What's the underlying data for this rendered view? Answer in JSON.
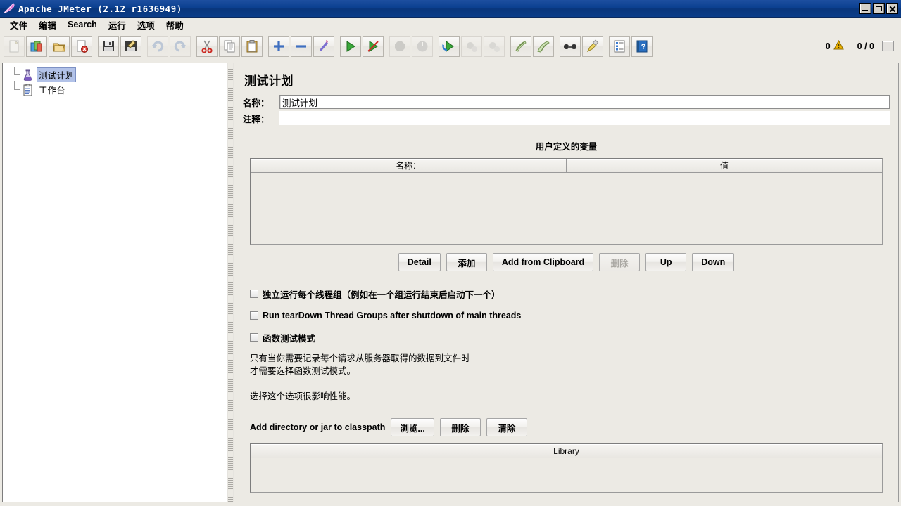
{
  "window": {
    "title": "Apache JMeter (2.12 r1636949)",
    "logo_icon": "jmeter-feather-icon",
    "minimize_icon": "minimize-icon",
    "maximize_icon": "maximize-icon",
    "close_icon": "close-icon"
  },
  "menu": {
    "items": [
      {
        "label": "文件"
      },
      {
        "label": "编辑"
      },
      {
        "label": "Search"
      },
      {
        "label": "运行"
      },
      {
        "label": "选项"
      },
      {
        "label": "帮助"
      }
    ]
  },
  "toolbar": {
    "buttons": [
      {
        "icon": "new-icon",
        "enabled": false
      },
      {
        "icon": "templates-icon",
        "enabled": true
      },
      {
        "icon": "open-icon",
        "enabled": true
      },
      {
        "icon": "close-file-icon",
        "enabled": true
      },
      {
        "icon": "save-icon",
        "enabled": true
      },
      {
        "icon": "save-as-icon",
        "enabled": true
      },
      {
        "icon": "undo-icon",
        "enabled": false
      },
      {
        "icon": "redo-icon",
        "enabled": false
      },
      {
        "icon": "cut-icon",
        "enabled": true
      },
      {
        "icon": "copy-icon",
        "enabled": true
      },
      {
        "icon": "paste-icon",
        "enabled": true
      },
      {
        "icon": "expand-all-icon",
        "enabled": true
      },
      {
        "icon": "collapse-all-icon",
        "enabled": true
      },
      {
        "icon": "toggle-icon",
        "enabled": true
      },
      {
        "icon": "start-icon",
        "enabled": true
      },
      {
        "icon": "start-no-pauses-icon",
        "enabled": true
      },
      {
        "icon": "stop-icon",
        "enabled": false
      },
      {
        "icon": "shutdown-icon",
        "enabled": false
      },
      {
        "icon": "remote-start-all-icon",
        "enabled": true
      },
      {
        "icon": "remote-stop-all-icon",
        "enabled": false
      },
      {
        "icon": "remote-shutdown-all-icon",
        "enabled": false
      },
      {
        "icon": "clear-icon",
        "enabled": true
      },
      {
        "icon": "clear-all-icon",
        "enabled": true
      },
      {
        "icon": "search-icon",
        "enabled": true
      },
      {
        "icon": "search-reset-icon",
        "enabled": true
      },
      {
        "icon": "function-helper-icon",
        "enabled": true
      },
      {
        "icon": "help-icon",
        "enabled": true
      }
    ],
    "status": {
      "error_count": "0",
      "warning_icon": "warning-triangle-icon",
      "threads": "0 / 0",
      "progress_icon": "progress-box-icon"
    }
  },
  "tree": {
    "nodes": [
      {
        "label": "测试计划",
        "icon": "test-plan-flask-icon",
        "selected": true
      },
      {
        "label": "工作台",
        "icon": "workbench-clipboard-icon",
        "selected": false
      }
    ]
  },
  "main": {
    "heading": "测试计划",
    "name_label": "名称：",
    "name_value": "测试计划",
    "comment_label": "注释：",
    "comment_value": "",
    "variables": {
      "title": "用户定义的变量",
      "columns": [
        "名称：",
        "值"
      ],
      "rows": []
    },
    "var_buttons": [
      {
        "label": "Detail",
        "enabled": true
      },
      {
        "label": "添加",
        "enabled": true
      },
      {
        "label": "Add from Clipboard",
        "enabled": true
      },
      {
        "label": "删除",
        "enabled": false
      },
      {
        "label": "Up",
        "enabled": true
      },
      {
        "label": "Down",
        "enabled": true
      }
    ],
    "checkboxes": [
      {
        "label": "独立运行每个线程组（例如在一个组运行结束后启动下一个）",
        "checked": false
      },
      {
        "label": "Run tearDown Thread Groups after shutdown of main threads",
        "checked": false
      },
      {
        "label": "函数测试模式",
        "checked": false
      }
    ],
    "help_line1": "只有当你需要记录每个请求从服务器取得的数据到文件时",
    "help_line2": "才需要选择函数测试模式。",
    "help_line3": "选择这个选项很影响性能。",
    "classpath_label": "Add directory or jar to classpath",
    "classpath_buttons": [
      {
        "label": "浏览...",
        "enabled": true
      },
      {
        "label": "删除",
        "enabled": true
      },
      {
        "label": "清除",
        "enabled": true
      }
    ],
    "library": {
      "column": "Library",
      "rows": []
    }
  },
  "colors": {
    "titlebar": "#0a3f8f",
    "panel": "#eceae4",
    "selection": "#b2c2e8",
    "warning": "#f0b400"
  }
}
